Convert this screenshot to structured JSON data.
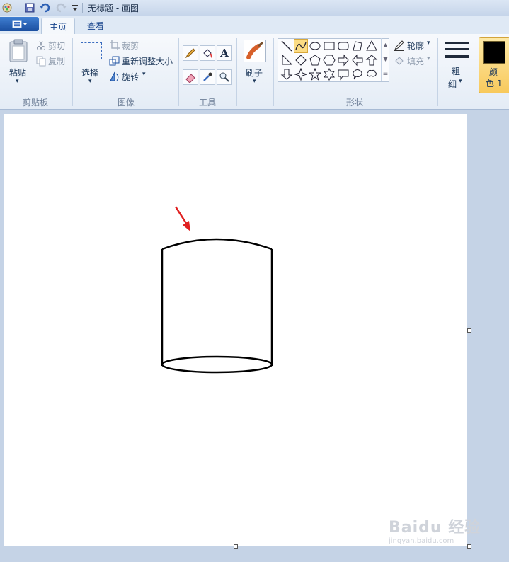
{
  "window": {
    "title": "无标题 - 画图"
  },
  "tabs": [
    {
      "label": "主页"
    },
    {
      "label": "查看"
    }
  ],
  "ribbon": {
    "clipboard": {
      "paste": "粘贴",
      "cut": "剪切",
      "copy": "复制",
      "group": "剪贴板"
    },
    "image": {
      "select": "选择",
      "crop": "裁剪",
      "resize": "重新调整大小",
      "rotate": "旋转",
      "group": "图像"
    },
    "tools": {
      "group": "工具"
    },
    "brush": {
      "label": "刷子"
    },
    "shapes": {
      "outline": "轮廓",
      "fill": "填充",
      "group": "形状"
    },
    "size": {
      "label_line1": "粗",
      "label_line2": "细"
    },
    "color1": {
      "label_line1": "颜",
      "label_line2": "色 1",
      "swatch": "#000000"
    }
  },
  "shape_icons": [
    "line-icon",
    "curve-icon",
    "oval-icon",
    "rectangle-icon",
    "rounded-rectangle-icon",
    "polygon-icon",
    "triangle-icon",
    "right-triangle-icon",
    "diamond-icon",
    "pentagon-icon",
    "hexagon-icon",
    "right-arrow-icon",
    "left-arrow-icon",
    "up-arrow-icon",
    "down-arrow-icon",
    "four-point-star-icon",
    "five-point-star-icon",
    "six-point-star-icon",
    "rect-callout-icon",
    "oval-callout-icon",
    "cloud-callout-icon"
  ],
  "colors": {
    "accent": "#1b4fa0",
    "selected_shape": "#fbdc84",
    "arrow": "#e02020"
  },
  "watermark": {
    "line1": "Baidu 经验",
    "line2": "jingyan.baidu.com"
  }
}
